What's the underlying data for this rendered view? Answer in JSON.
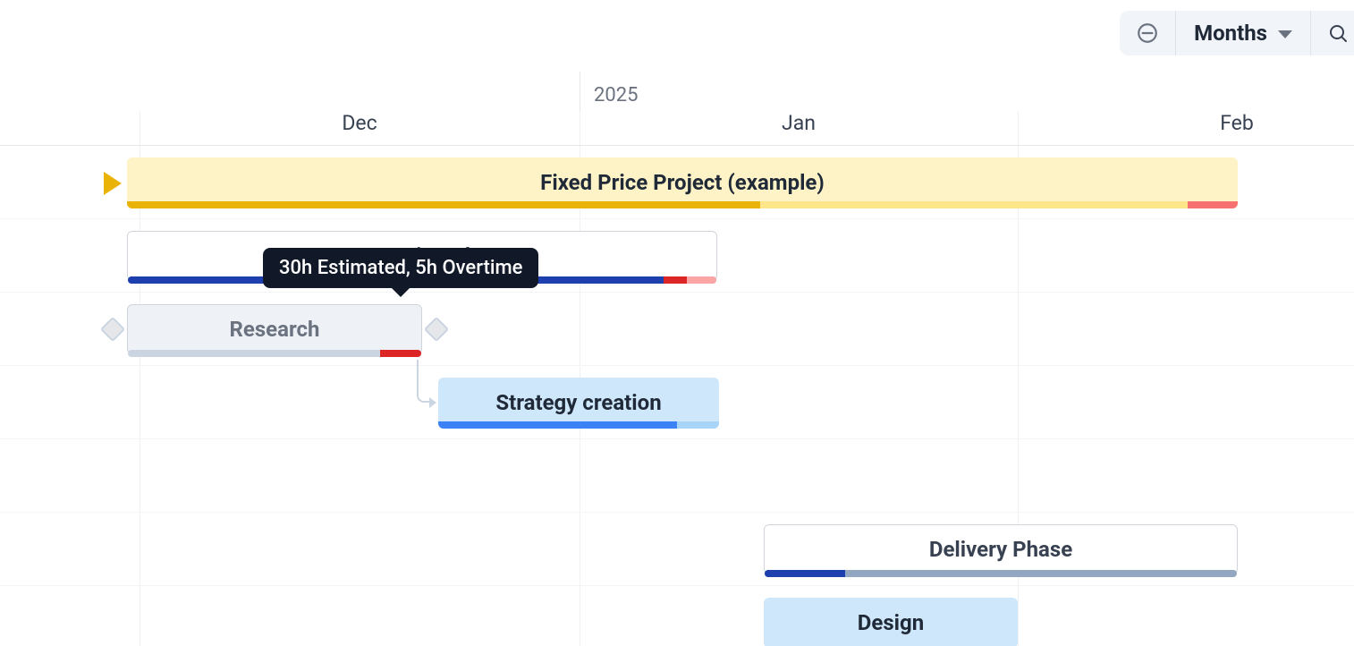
{
  "toolbar": {
    "scale_label": "Months"
  },
  "timeline": {
    "year_label": "2025",
    "months": [
      "Dec",
      "Jan",
      "Feb"
    ]
  },
  "bars": {
    "project": {
      "label": "Fixed Price Project (example)"
    },
    "prep_phase": {
      "label": "Preparation Phase"
    },
    "research": {
      "label": "Research"
    },
    "strategy": {
      "label": "Strategy creation"
    },
    "delivery_phase": {
      "label": "Delivery Phase"
    },
    "design": {
      "label": "Design"
    }
  },
  "tooltip": {
    "text": "30h Estimated, 5h Overtime"
  }
}
